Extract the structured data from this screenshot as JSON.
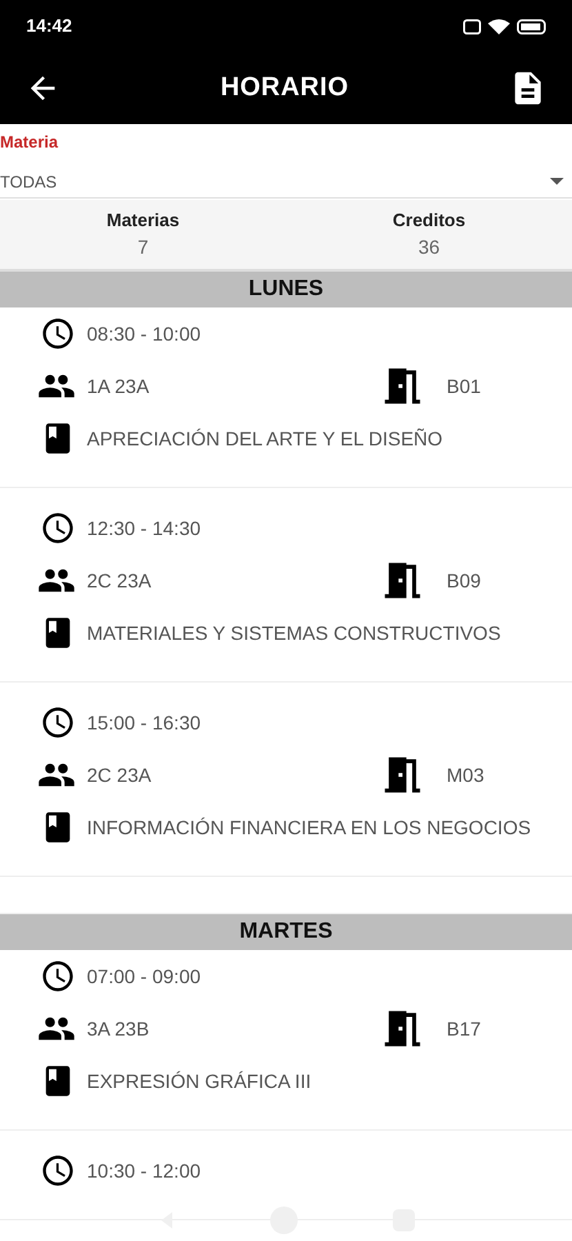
{
  "status_bar": {
    "time": "14:42"
  },
  "app_bar": {
    "title": "HORARIO"
  },
  "filter": {
    "label": "Materia",
    "value": "TODAS"
  },
  "summary": [
    {
      "label": "Materias",
      "value": "7"
    },
    {
      "label": "Creditos",
      "value": "36"
    }
  ],
  "days": [
    {
      "name": "LUNES",
      "classes": [
        {
          "time": "08:30 - 10:00",
          "group": "1A 23A",
          "room": "B01",
          "subject": "APRECIACIÓN DEL ARTE Y EL DISEÑO"
        },
        {
          "time": "12:30 - 14:30",
          "group": "2C 23A",
          "room": "B09",
          "subject": "MATERIALES Y SISTEMAS CONSTRUCTIVOS"
        },
        {
          "time": "15:00 - 16:30",
          "group": "2C 23A",
          "room": "M03",
          "subject": "INFORMACIÓN FINANCIERA EN LOS NEGOCIOS"
        }
      ]
    },
    {
      "name": "MARTES",
      "classes": [
        {
          "time": "07:00 - 09:00",
          "group": "3A 23B",
          "room": "B17",
          "subject": "EXPRESIÓN GRÁFICA III"
        },
        {
          "time": "10:30 - 12:00"
        }
      ]
    }
  ]
}
